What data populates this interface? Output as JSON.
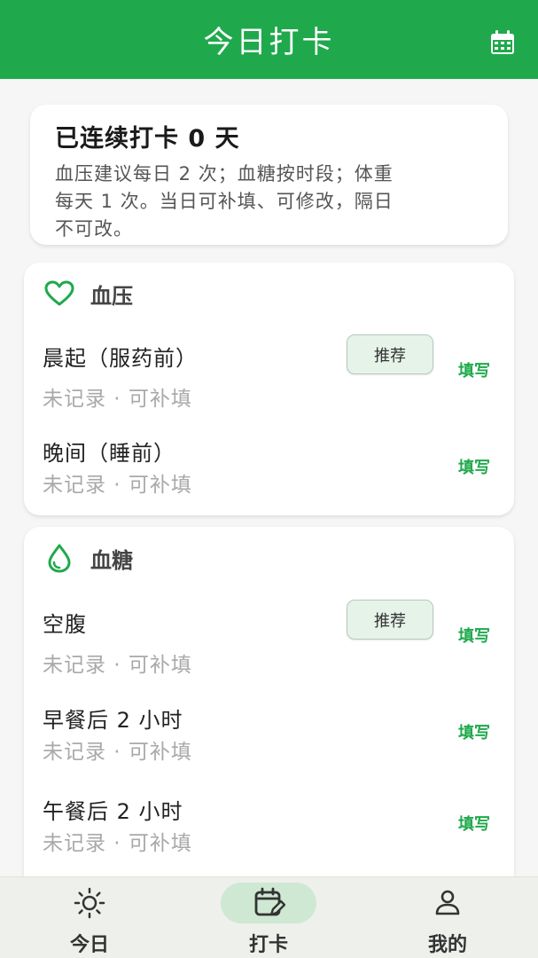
{
  "header": {
    "title": "今日打卡",
    "calendar_icon": "calendar-icon"
  },
  "streak": {
    "title": "已连续打卡 0 天",
    "desc_lines": [
      "血压建议每日 2 次；血糖按时段；体重",
      "每天 1 次。当日可补填、可修改，隔日",
      "不可改。"
    ]
  },
  "blood_pressure": {
    "label": "血压",
    "icon": "heart-icon",
    "entries": [
      {
        "name": "晨起（服药前）",
        "status": "未记录 · 可补填",
        "recommend": "推荐",
        "action": "填写"
      },
      {
        "name": "晚间（睡前）",
        "status": "未记录 · 可补填",
        "action": "填写"
      }
    ]
  },
  "blood_sugar": {
    "label": "血糖",
    "icon": "drop-icon",
    "entries": [
      {
        "name": "空腹",
        "status": "未记录 · 可补填",
        "recommend": "推荐",
        "action": "填写"
      },
      {
        "name": "早餐后 2 小时",
        "status": "未记录 · 可补填",
        "action": "填写"
      },
      {
        "name": "午餐后 2 小时",
        "status": "未记录 · 可补填",
        "action": "填写"
      }
    ]
  },
  "nav": [
    {
      "label": "今日",
      "icon": "sun-icon",
      "active": false
    },
    {
      "label": "打卡",
      "icon": "calendar-edit-icon",
      "active": true
    },
    {
      "label": "我的",
      "icon": "person-icon",
      "active": false
    }
  ],
  "colors": {
    "accent": "#1fa94c",
    "nav_active_bg": "#cfe8d3",
    "recommend_bg": "#e6f3e9"
  }
}
